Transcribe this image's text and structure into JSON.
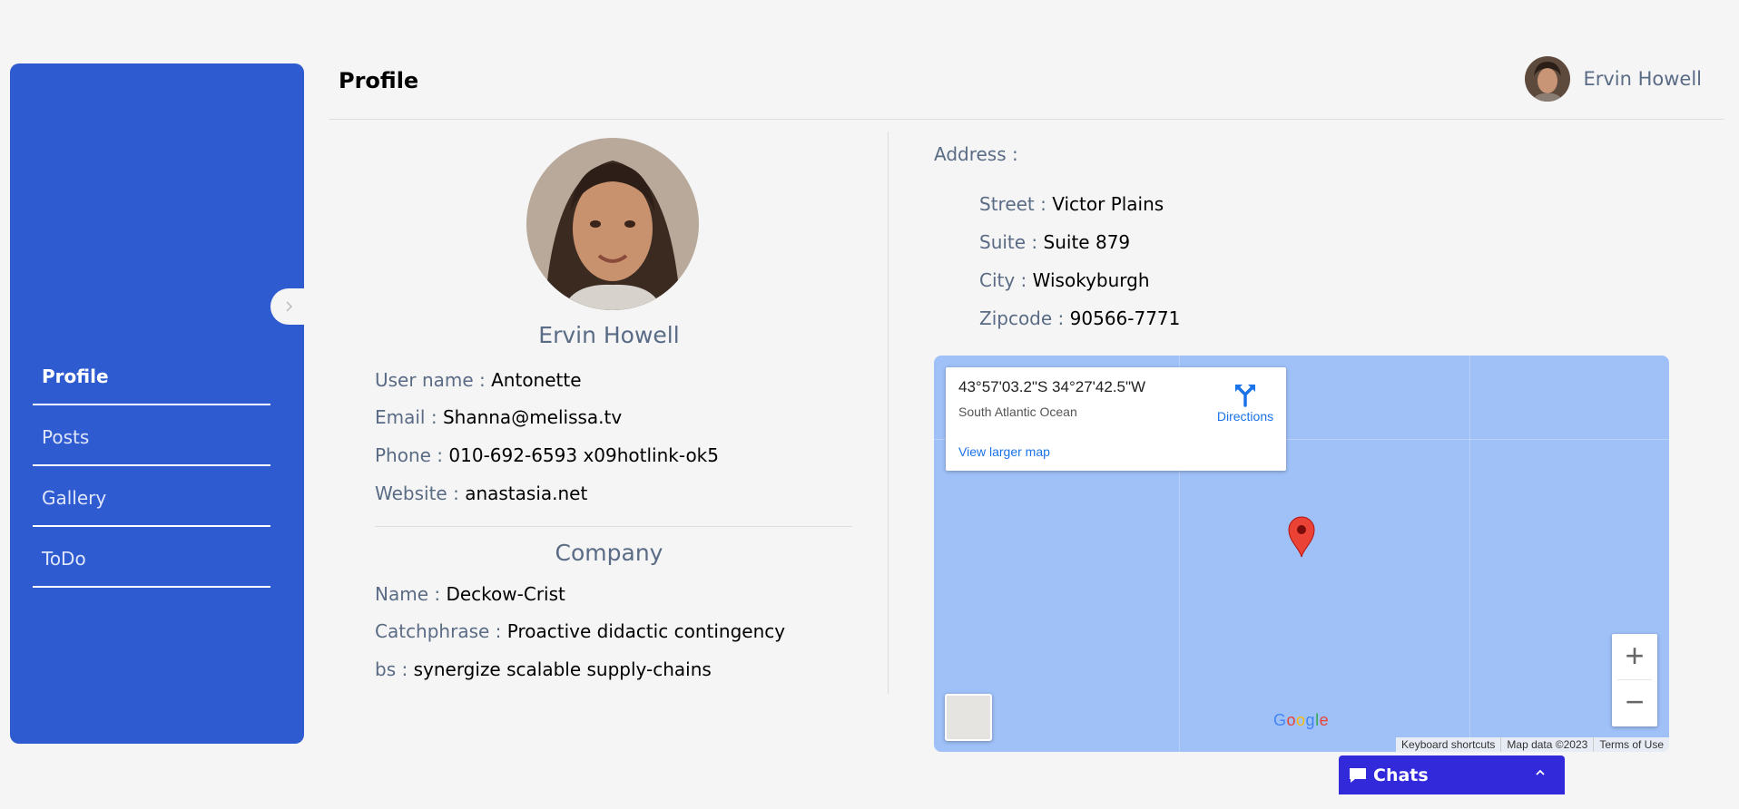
{
  "sidebar": {
    "items": [
      {
        "label": "Profile",
        "active": true
      },
      {
        "label": "Posts"
      },
      {
        "label": "Gallery"
      },
      {
        "label": "ToDo"
      }
    ]
  },
  "header": {
    "title": "Profile",
    "user_name": "Ervin Howell"
  },
  "profile": {
    "name": "Ervin Howell",
    "fields": [
      {
        "label": "User name : ",
        "value": "Antonette"
      },
      {
        "label": "Email : ",
        "value": "Shanna@melissa.tv"
      },
      {
        "label": "Phone : ",
        "value": "010-692-6593 x09hotlink-ok5"
      },
      {
        "label": "Website : ",
        "value": "anastasia.net"
      }
    ],
    "company": {
      "title": "Company",
      "fields": [
        {
          "label": "Name : ",
          "value": "Deckow-Crist"
        },
        {
          "label": "Catchphrase : ",
          "value": "Proactive didactic contingency"
        },
        {
          "label": "bs : ",
          "value": "synergize scalable supply-chains"
        }
      ]
    }
  },
  "address": {
    "title": "Address :",
    "fields": [
      {
        "label": "Street : ",
        "value": "Victor Plains"
      },
      {
        "label": "Suite : ",
        "value": "Suite 879"
      },
      {
        "label": "City : ",
        "value": "Wisokyburgh"
      },
      {
        "label": "Zipcode : ",
        "value": "90566-7771"
      }
    ]
  },
  "map": {
    "coordinates": "43°57'03.2\"S 34°27'42.5\"W",
    "place": "South Atlantic Ocean",
    "directions_label": "Directions",
    "larger_map_label": "View larger map",
    "zoom_in": "+",
    "zoom_out": "−",
    "attribution": [
      "Keyboard shortcuts",
      "Map data ©2023",
      "Terms of Use"
    ],
    "water_color": "#9fc1f8",
    "pin_color": "#ea4335"
  },
  "chats": {
    "label": "Chats"
  },
  "colors": {
    "sidebar": "#2f5bd1",
    "chats": "#3229db",
    "label": "#5a6b85"
  }
}
